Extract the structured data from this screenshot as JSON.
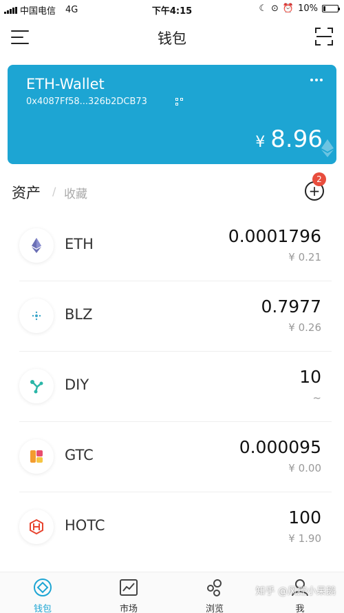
{
  "status_bar": {
    "carrier": "中国电信",
    "network": "4G",
    "time": "下午4:15",
    "battery": "10%"
  },
  "header": {
    "title": "钱包",
    "menu_icon": "menu-icon",
    "scan_icon": "scan-icon"
  },
  "wallet": {
    "name": "ETH-Wallet",
    "address": "0x4087Ff58...326b2DCB73",
    "currency_symbol": "¥",
    "balance": "8.96",
    "color": "#1da5d3"
  },
  "assets": {
    "tab_assets": "资产",
    "tab_separator": "/",
    "tab_favorites": "收藏",
    "badge_count": "2",
    "badge_color": "#e84d3d"
  },
  "tokens": [
    {
      "symbol": "ETH",
      "amount": "0.0001796",
      "value": "¥ 0.21",
      "icon": "eth-icon"
    },
    {
      "symbol": "BLZ",
      "amount": "0.7977",
      "value": "¥ 0.26",
      "icon": "blz-icon"
    },
    {
      "symbol": "DIY",
      "amount": "10",
      "value": "~",
      "icon": "diy-icon"
    },
    {
      "symbol": "GTC",
      "amount": "0.000095",
      "value": "¥ 0.00",
      "icon": "gtc-icon"
    },
    {
      "symbol": "HOTC",
      "amount": "100",
      "value": "¥ 1.90",
      "icon": "hotc-icon"
    }
  ],
  "bottom_nav": [
    {
      "label": "钱包",
      "icon": "wallet-icon",
      "active": true
    },
    {
      "label": "市场",
      "icon": "market-icon",
      "active": false
    },
    {
      "label": "浏览",
      "icon": "browse-icon",
      "active": false
    },
    {
      "label": "我",
      "icon": "profile-icon",
      "active": false
    }
  ],
  "watermark": "知乎 @风控小呆鹅"
}
